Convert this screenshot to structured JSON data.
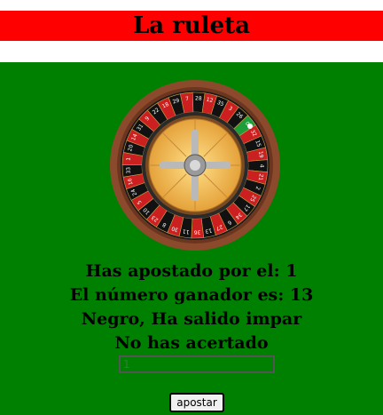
{
  "header": {
    "title": "La ruleta",
    "bar_color": "#ff0000"
  },
  "wheel": {
    "icon": "roulette-wheel-icon",
    "numbers": [
      "0",
      "32",
      "15",
      "19",
      "4",
      "21",
      "2",
      "25",
      "17",
      "34",
      "6",
      "27",
      "13",
      "36",
      "11",
      "30",
      "8",
      "23",
      "10",
      "5",
      "24",
      "16",
      "33",
      "1",
      "20",
      "14",
      "31",
      "9",
      "22",
      "18",
      "29",
      "7",
      "28",
      "12",
      "35",
      "3",
      "26"
    ]
  },
  "result": {
    "bet_line": "Has apostado por el: 1",
    "winning_line": "El número ganador es: 13",
    "color_parity_line": "Negro, Ha salido impar",
    "outcome_line": "No has acertado"
  },
  "form": {
    "bet_value": "1",
    "bet_placeholder": "1",
    "submit_label": "apostar"
  },
  "colors": {
    "table_green": "#008000",
    "red": "#ff0000",
    "black": "#000000"
  }
}
